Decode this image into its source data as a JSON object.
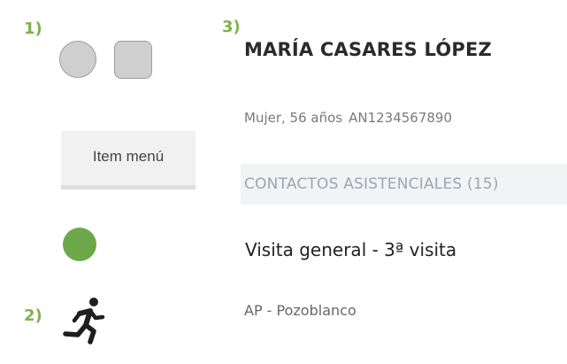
{
  "markers": {
    "one": "1)",
    "two": "2)",
    "three": "3)"
  },
  "menu_item": {
    "label": "Item menú"
  },
  "patient": {
    "name": "MARÍA CASARES LÓPEZ",
    "demographics": "Mujer, 56 años",
    "id": "AN1234567890"
  },
  "contacts": {
    "title": "CONTACTOS ASISTENCIALES (15)"
  },
  "visit": {
    "title": "Visita general - 3ª visita",
    "location": "AP - Pozoblanco"
  },
  "colors": {
    "marker_green": "#7fb34a",
    "status_dot_green": "#6ca84a",
    "shape_gray": "#cfcfcf",
    "contacts_bar_bg": "#f2f3f4",
    "contacts_text": "#9aa6b2"
  },
  "icons": {
    "runner": "running-person-icon"
  }
}
